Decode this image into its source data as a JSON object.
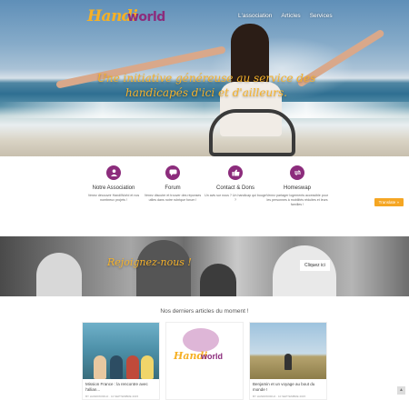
{
  "header": {
    "logo_part1": "Handi",
    "logo_part2": "world",
    "nav": [
      "L'association",
      "Articles",
      "Services"
    ],
    "tagline": "Une initiative généreuse au service des handicapés d'ici et d'ailleurs."
  },
  "features": [
    {
      "icon": "users-icon",
      "title": "Notre Association",
      "desc": "Venez découvrir HandiWorld et nos nombreux projets !"
    },
    {
      "icon": "chat-icon",
      "title": "Forum",
      "desc": "Venez discuter et trouver des réponses utiles dans notre rubrique forum !"
    },
    {
      "icon": "thumbs-up-icon",
      "title": "Contact & Dons",
      "desc": "Un avis sur nous ? Un handicap qui bouge ?"
    },
    {
      "icon": "exchange-icon",
      "title": "Homeswap",
      "desc": "Venez partager logements accessible pour les personnes à mobilités réduites et leurs familles !"
    }
  ],
  "translate_label": "Translate »",
  "band": {
    "join": "Rejoignez-nous !",
    "cta": "Cliquez ici"
  },
  "articles": {
    "heading": "Nos derniers articles du moment !",
    "items": [
      {
        "title": "Mission France : la rencontre avec l'allian...",
        "meta": "BY HANDIWORLD · 10 SEPTEMBRE 2015"
      },
      {
        "title": "",
        "meta": ""
      },
      {
        "title": "Benjamin et un voyage au bout du monde !",
        "meta": "BY HANDIWORLD · 10 SEPTEMBRE 2015"
      }
    ]
  },
  "colors": {
    "brand_purple": "#8c2c7c",
    "brand_orange": "#f5b22b"
  }
}
